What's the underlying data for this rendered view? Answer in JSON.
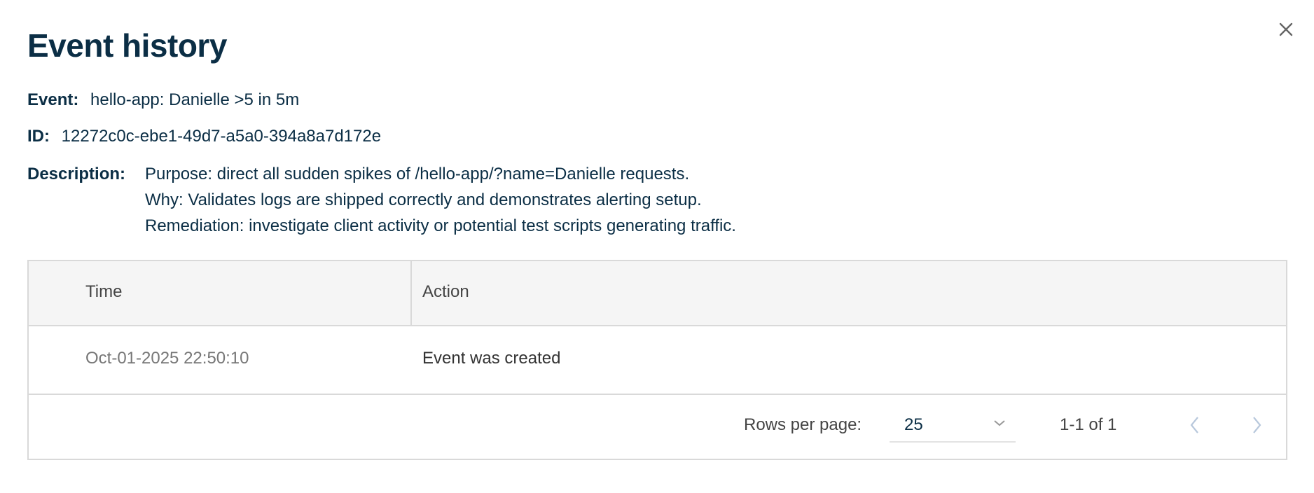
{
  "dialog": {
    "title": "Event history",
    "close_icon": "close-icon"
  },
  "details": {
    "event_label": "Event:",
    "event_value": "hello-app: Danielle >5 in 5m",
    "id_label": "ID:",
    "id_value": "12272c0c-ebe1-49d7-a5a0-394a8a7d172e",
    "description_label": "Description:",
    "description_lines": [
      "Purpose: direct all sudden spikes of /hello-app/?name=Danielle requests.",
      "Why: Validates logs are shipped correctly and demonstrates alerting setup.",
      "Remediation: investigate client activity or potential test scripts generating traffic."
    ]
  },
  "table": {
    "columns": [
      "Time",
      "Action"
    ],
    "rows": [
      {
        "time": "Oct-01-2025 22:50:10",
        "action": "Event was created"
      }
    ]
  },
  "pagination": {
    "rows_per_page_label": "Rows per page:",
    "rows_per_page_value": "25",
    "range_text": "1-1 of 1"
  },
  "colors": {
    "text_primary": "#0b2e45",
    "border": "#d9d9d9",
    "header_bg": "#f5f5f5",
    "disabled_arrow": "#b8c8dc"
  }
}
